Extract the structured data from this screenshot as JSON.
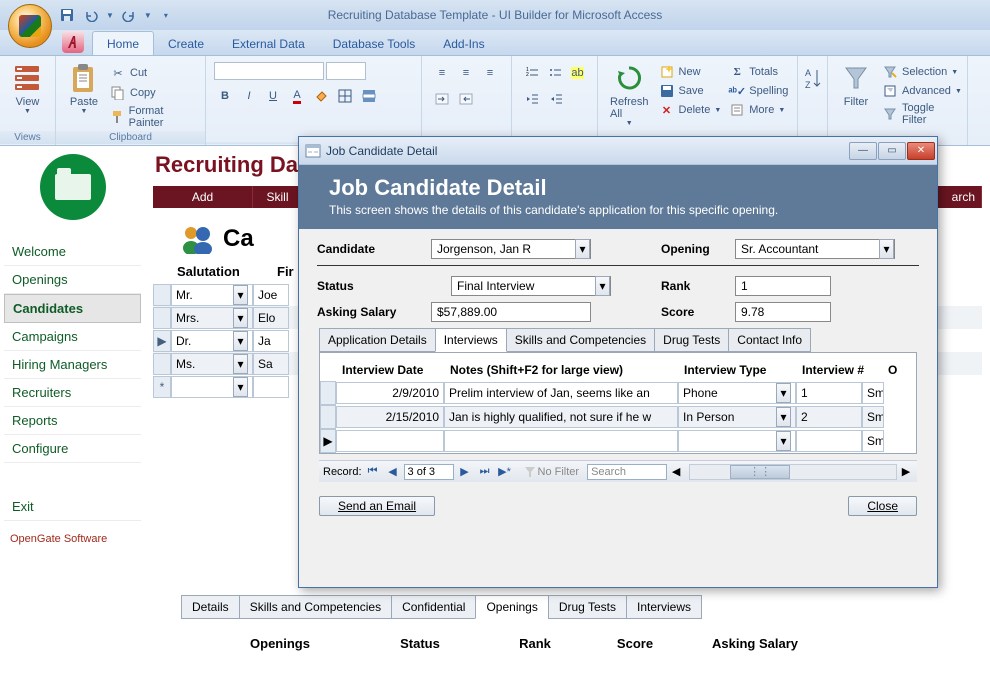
{
  "title": "Recruiting Database Template - UI Builder for Microsoft Access",
  "ribbon_tabs": [
    "Home",
    "Create",
    "External Data",
    "Database Tools",
    "Add-Ins"
  ],
  "ribbon": {
    "views_label": "Views",
    "view": "View",
    "clipboard_label": "Clipboard",
    "paste": "Paste",
    "cut": "Cut",
    "copy": "Copy",
    "fp": "Format Painter",
    "records": {
      "refresh": "Refresh All",
      "new": "New",
      "save": "Save",
      "delete": "Delete",
      "totals": "Totals",
      "spelling": "Spelling",
      "more": "More"
    },
    "filter": "Filter",
    "selection": "Selection",
    "advanced": "Advanced",
    "toggle": "Toggle Filter"
  },
  "page": {
    "heading": "Recruiting Datab",
    "section": "Ca"
  },
  "buttonbar": {
    "add": "Add",
    "skill": "Skill"
  },
  "nav": [
    "Welcome",
    "Openings",
    "Candidates",
    "Campaigns",
    "Hiring Managers",
    "Recruiters",
    "Reports",
    "Configure",
    "Exit"
  ],
  "nav_active": "Candidates",
  "nav_footer": "OpenGate Software",
  "grid": {
    "headers": {
      "sal": "Salutation",
      "fir": "Fir"
    },
    "rows": [
      {
        "sal": "Mr.",
        "name": "Joe"
      },
      {
        "sal": "Mrs.",
        "name": "Elo"
      },
      {
        "sal": "Dr.",
        "name": "Ja",
        "cur": true
      },
      {
        "sal": "Ms.",
        "name": "Sa"
      },
      {
        "sal": "",
        "name": "",
        "star": true
      }
    ]
  },
  "bottom_tabs": [
    "Details",
    "Skills and Competencies",
    "Confidential",
    "Openings",
    "Drug Tests",
    "Interviews"
  ],
  "bottom_tabs_active": "Openings",
  "openings_headers": [
    "Openings",
    "Status",
    "Rank",
    "Score",
    "Asking Salary"
  ],
  "dialog": {
    "title": "Job Candidate Detail",
    "banner_title": "Job Candidate Detail",
    "banner_sub": "This screen shows the details of this candidate's application for this specific opening.",
    "candidate_label": "Candidate",
    "candidate": "Jorgenson, Jan R",
    "opening_label": "Opening",
    "opening": "Sr. Accountant",
    "status_label": "Status",
    "status": "Final Interview",
    "rank_label": "Rank",
    "rank": "1",
    "salary_label": "Asking Salary",
    "salary": "$57,889.00",
    "score_label": "Score",
    "score": "9.78",
    "tabs": [
      "Application Details",
      "Interviews",
      "Skills and Competencies",
      "Drug Tests",
      "Contact Info"
    ],
    "tabs_active": "Interviews",
    "itable": {
      "headers": {
        "date": "Interview Date",
        "notes": "Notes (Shift+F2 for large view)",
        "type": "Interview Type",
        "num": "Interview #",
        "o": "O"
      },
      "rows": [
        {
          "date": "2/9/2010",
          "notes": "Prelim interview of Jan, seems like an",
          "type": "Phone",
          "num": "1",
          "o": "Sm"
        },
        {
          "date": "2/15/2010",
          "notes": "Jan is highly qualified, not sure if he w",
          "type": "In Person",
          "num": "2",
          "o": "Sm"
        },
        {
          "date": "",
          "notes": "",
          "type": "",
          "num": "",
          "o": "Sm",
          "cur": true
        }
      ]
    },
    "record": {
      "label": "Record:",
      "pos": "3 of 3",
      "nofilter": "No Filter",
      "search": "Search",
      "search_ic": "arch"
    },
    "email": "Send an Email",
    "close": "Close"
  }
}
